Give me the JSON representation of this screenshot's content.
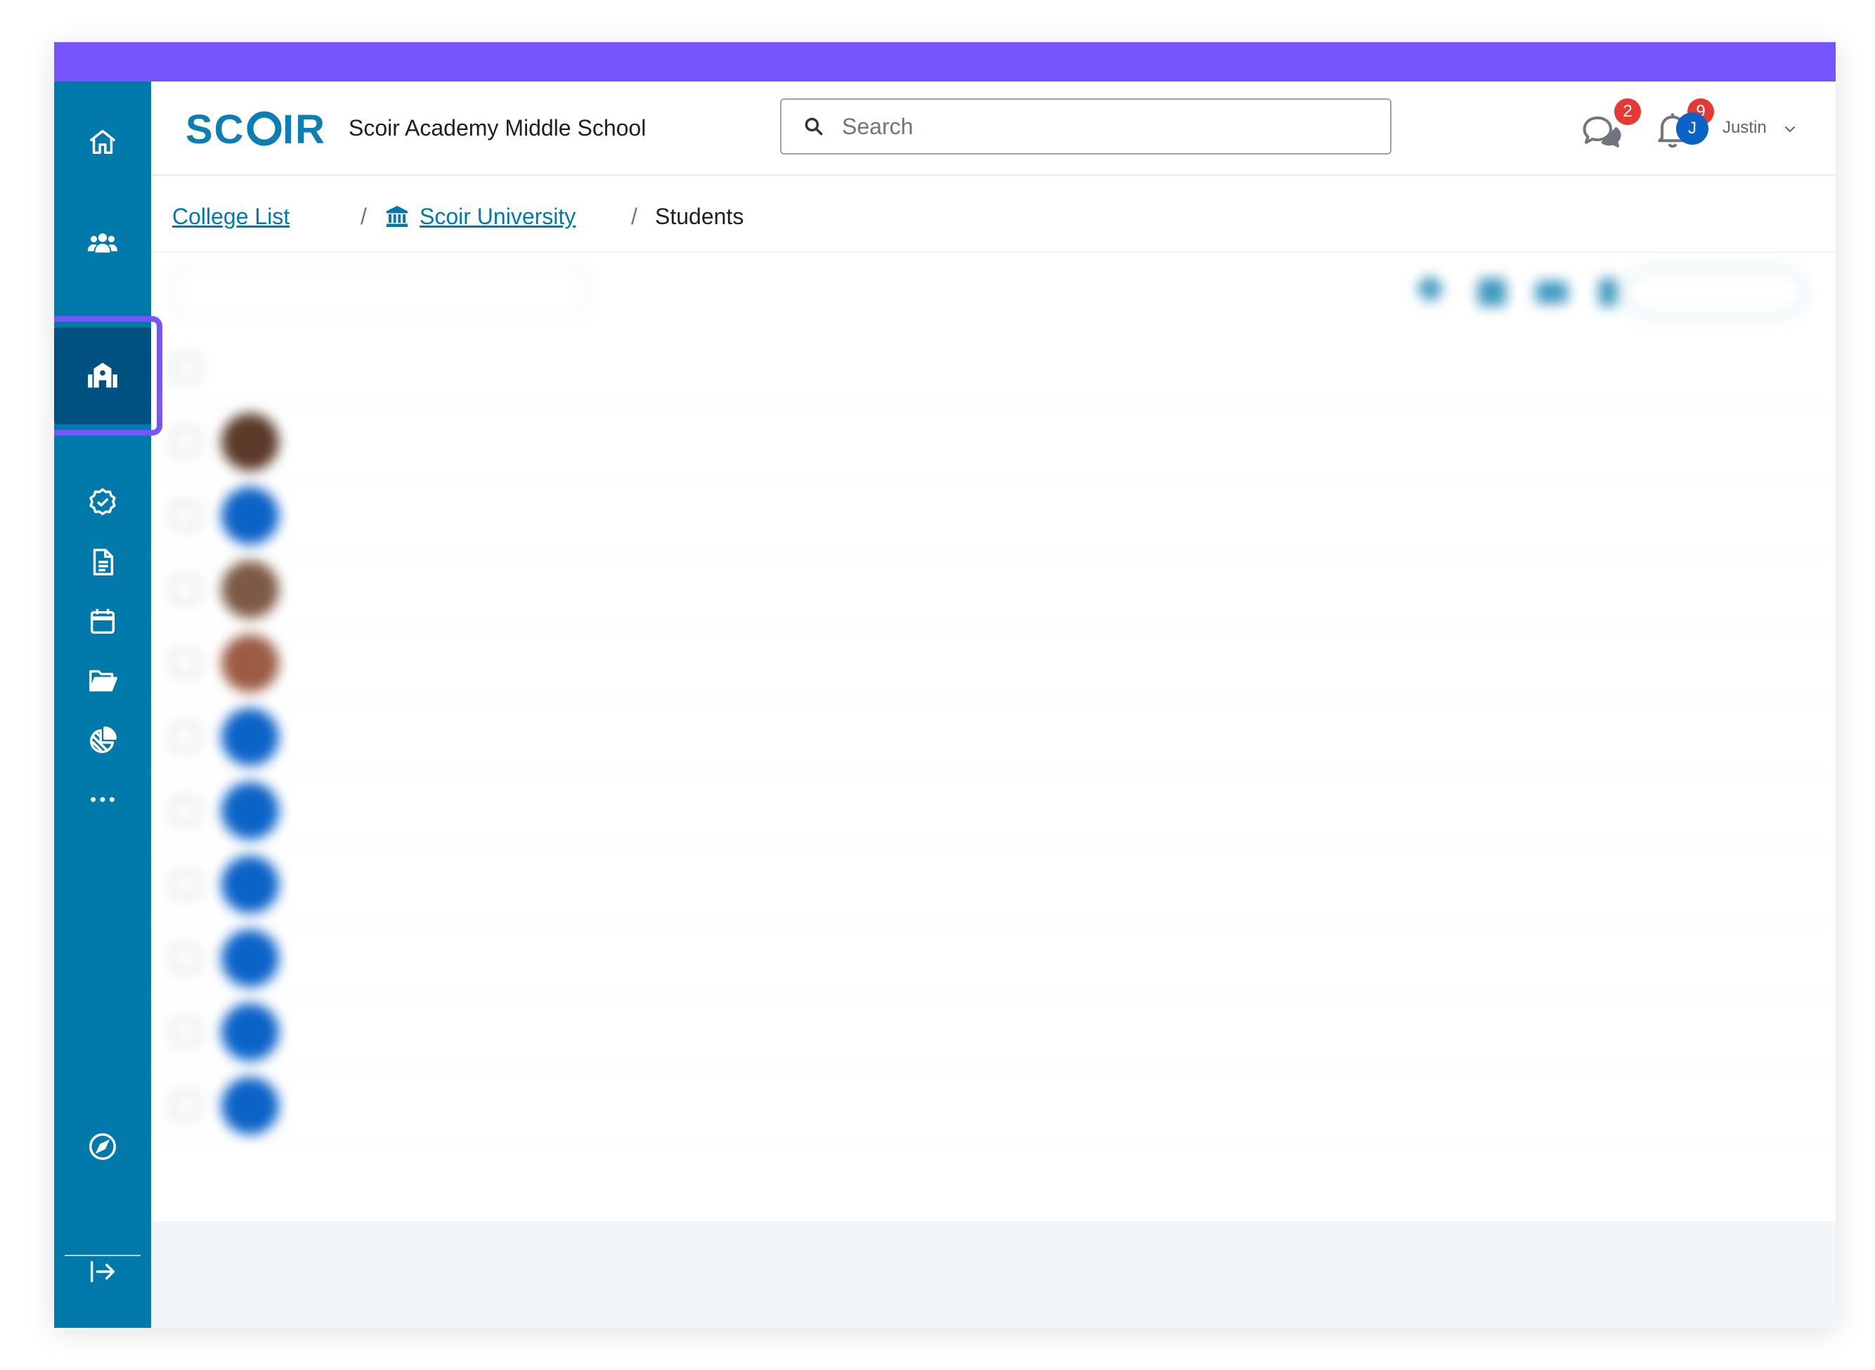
{
  "colors": {
    "accent": "#7755fc",
    "sidebar": "#0279ab",
    "sidebar_active": "#005180",
    "badge": "#e53935",
    "link": "#0279ab"
  },
  "sidebar": {
    "items": [
      {
        "icon": "home-icon"
      },
      {
        "icon": "users-icon"
      },
      {
        "icon": "school-icon",
        "active": true
      },
      {
        "icon": "check-badge-icon"
      },
      {
        "icon": "document-icon"
      },
      {
        "icon": "calendar-icon"
      },
      {
        "icon": "folder-open-icon"
      },
      {
        "icon": "pie-chart-icon"
      },
      {
        "icon": "more-icon"
      },
      {
        "icon": "compass-icon"
      },
      {
        "icon": "sign-out-icon"
      }
    ]
  },
  "header": {
    "logo": "SCOIR",
    "school_name": "Scoir Academy Middle School",
    "search_placeholder": "Search",
    "messages_count": "2",
    "notifications_count": "9",
    "user_initial": "J",
    "user_name": "Justin"
  },
  "breadcrumb": {
    "items": [
      "College List",
      "Scoir University"
    ],
    "separator": "/",
    "current": "Students"
  }
}
